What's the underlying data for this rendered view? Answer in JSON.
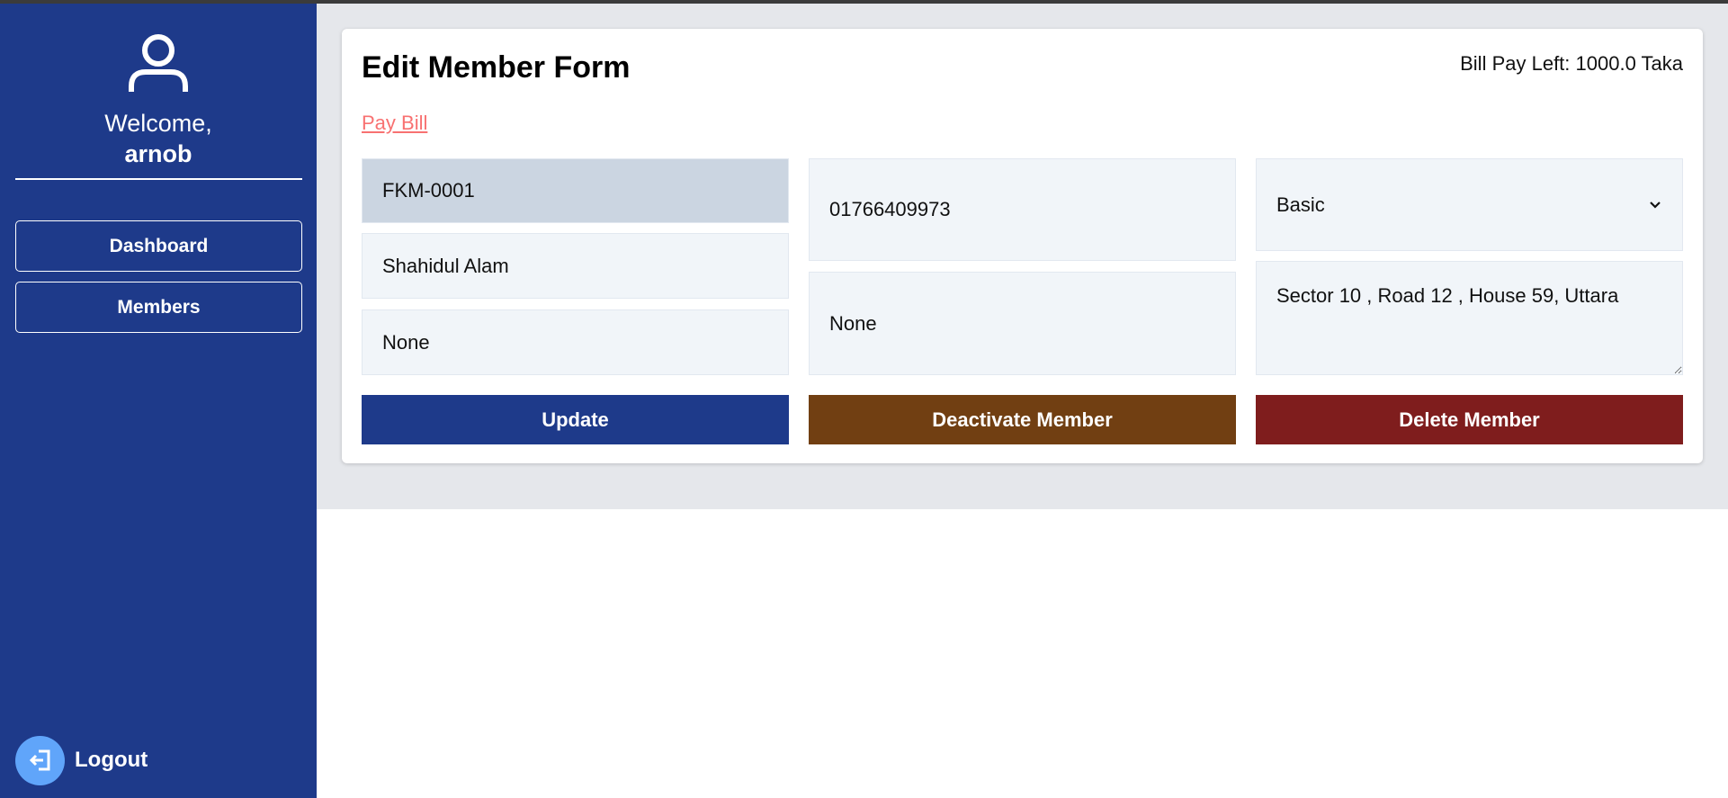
{
  "sidebar": {
    "welcome_text": "Welcome,",
    "username": "arnob",
    "nav": [
      {
        "label": "Dashboard"
      },
      {
        "label": "Members"
      }
    ],
    "logout_label": "Logout"
  },
  "form": {
    "title": "Edit Member Form",
    "bill_pay_left": "Bill Pay Left: 1000.0 Taka",
    "pay_bill_link": "Pay Bill",
    "member_id": "FKM-0001",
    "name": "Shahidul Alam",
    "field_left_3": "None",
    "phone": "01766409973",
    "field_mid_2": "None",
    "plan": "Basic",
    "address": "Sector 10 , Road 12 , House 59, Uttara"
  },
  "actions": {
    "update": "Update",
    "deactivate": "Deactivate Member",
    "delete": "Delete Member"
  },
  "colors": {
    "sidebar": "#1e3a8a",
    "update": "#1e3a8a",
    "deactivate": "#713f12",
    "delete": "#7f1d1d",
    "link": "#f87171",
    "logout_circle": "#60a5fa"
  },
  "icons": {
    "user": "user-icon",
    "logout": "logout-icon",
    "select_arrow": "chevron-down-icon"
  }
}
